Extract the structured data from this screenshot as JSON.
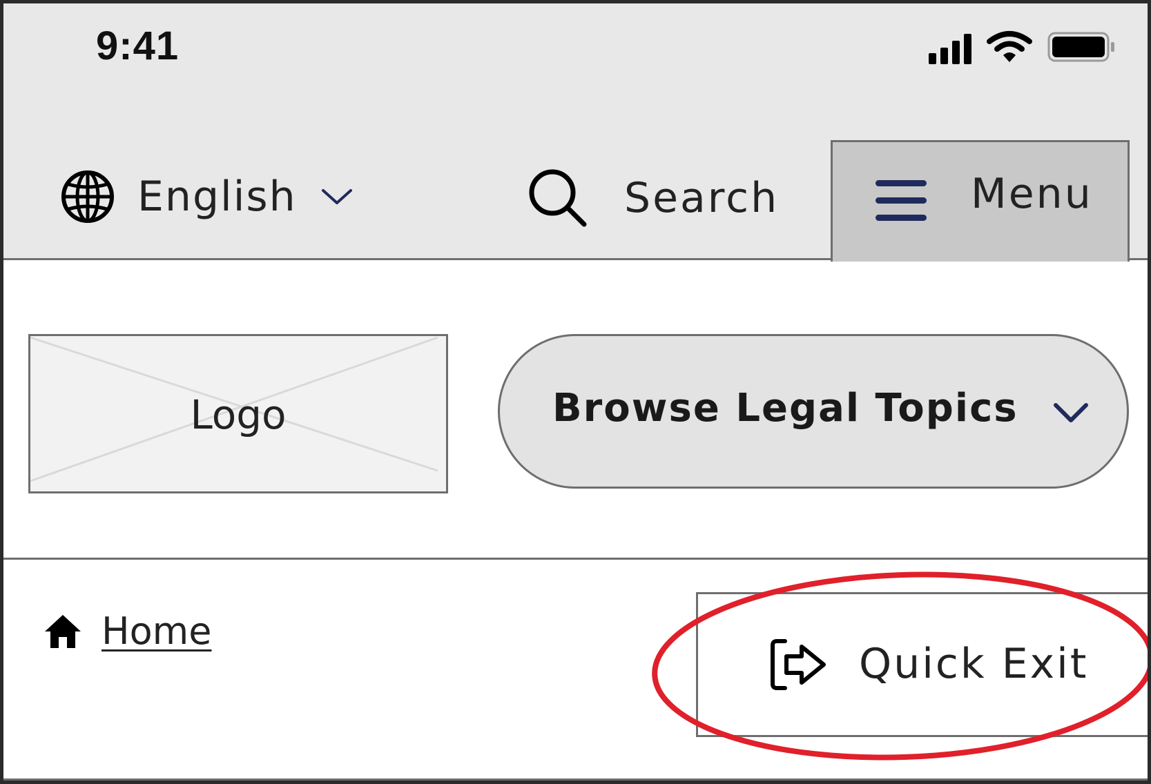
{
  "status_bar": {
    "time": "9:41",
    "icons": [
      "cellular-signal-icon",
      "wifi-icon",
      "battery-icon"
    ]
  },
  "header": {
    "language": {
      "label": "English",
      "icon": "globe-icon",
      "chevron": "chevron-down-icon"
    },
    "search": {
      "label": "Search",
      "icon": "search-icon"
    },
    "menu": {
      "label": "Menu",
      "icon": "hamburger-icon"
    }
  },
  "branding": {
    "logo_text": "Logo"
  },
  "browse": {
    "label": "Browse Legal Topics",
    "chevron": "chevron-down-icon"
  },
  "breadcrumb": {
    "home_label": "Home",
    "icon": "home-icon"
  },
  "quick_exit": {
    "label": "Quick Exit",
    "icon": "exit-icon"
  },
  "colors": {
    "header_bg": "#e8e8e8",
    "menu_bg": "#c8c8c8",
    "accent_navy": "#1f2b5c",
    "annotation_red": "#e0202a",
    "border_gray": "#6e6e6e"
  }
}
